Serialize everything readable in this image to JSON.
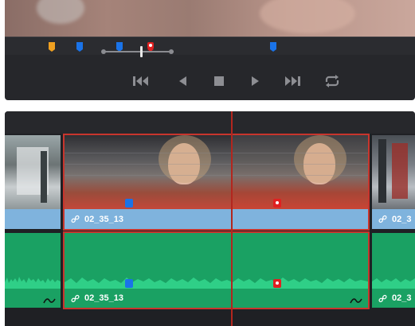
{
  "viewer": {
    "markers": [
      {
        "color": "#f0a020",
        "name": "orange"
      },
      {
        "color": "#1a73e8",
        "name": "blue"
      },
      {
        "color": "#1a73e8",
        "name": "blue"
      },
      {
        "color": "#e02020",
        "name": "red"
      },
      {
        "color": "#1a73e8",
        "name": "blue"
      }
    ],
    "transport_icons": [
      "jump-to-start-icon",
      "play-reverse-icon",
      "stop-icon",
      "play-icon",
      "jump-to-end-icon",
      "loop-icon"
    ]
  },
  "timeline": {
    "clips": {
      "video_left_label": "",
      "video_main_label": "02_35_13",
      "video_right_label": "02_3",
      "audio_main_label": "02_35_13",
      "audio_right_label": "02_3"
    },
    "colors": {
      "video_bar": "#7fb3dd",
      "audio": "#1aa163",
      "selection": "#c8352d",
      "playhead": "#b3261e",
      "marker_blue": "#1a73e8",
      "marker_red": "#e02020"
    }
  }
}
